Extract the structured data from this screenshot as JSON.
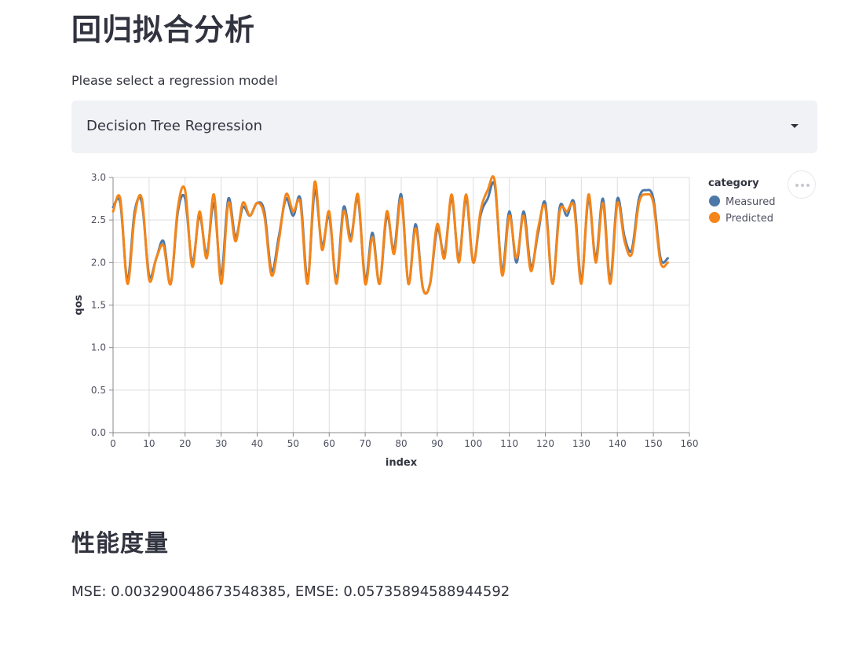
{
  "page": {
    "title": "回归拟合分析",
    "select_label": "Please select a regression model",
    "selected_model": "Decision Tree Regression"
  },
  "menu": {
    "icon": "more-horizontal-icon"
  },
  "metrics": {
    "title": "性能度量",
    "text": "MSE: 0.003290048673548385, EMSE: 0.05735894588944592"
  },
  "colors": {
    "measured": "#4c78a8",
    "predicted": "#f58518",
    "grid": "#dddddd",
    "axis": "#888888",
    "text": "#31333f"
  },
  "chart_data": {
    "type": "line",
    "xlabel": "index",
    "ylabel": "qos",
    "xlim": [
      0,
      160
    ],
    "ylim": [
      0,
      3
    ],
    "x_ticks": [
      0,
      10,
      20,
      30,
      40,
      50,
      60,
      70,
      80,
      90,
      100,
      110,
      120,
      130,
      140,
      150,
      160
    ],
    "y_ticks": [
      0.0,
      0.5,
      1.0,
      1.5,
      2.0,
      2.5,
      3.0
    ],
    "y_tick_labels": [
      "0.0",
      "0.5",
      "1.0",
      "1.5",
      "2.0",
      "2.5",
      "3.0"
    ],
    "grid": true,
    "legend": {
      "title": "category",
      "position": "right"
    },
    "interpolation": "smooth",
    "series": [
      {
        "name": "Measured",
        "color": "#4c78a8",
        "x": [
          0,
          2,
          4,
          6,
          8,
          10,
          12,
          14,
          16,
          18,
          20,
          22,
          24,
          26,
          28,
          30,
          32,
          34,
          36,
          38,
          40,
          42,
          44,
          46,
          48,
          50,
          52,
          54,
          56,
          58,
          60,
          62,
          64,
          66,
          68,
          70,
          72,
          74,
          76,
          78,
          80,
          82,
          84,
          86,
          88,
          90,
          92,
          94,
          96,
          98,
          100,
          102,
          104,
          106,
          108,
          110,
          112,
          114,
          116,
          118,
          120,
          122,
          124,
          126,
          128,
          130,
          132,
          134,
          136,
          138,
          140,
          142,
          144,
          146,
          148,
          150,
          152,
          154
        ],
        "y": [
          2.65,
          2.7,
          1.8,
          2.6,
          2.7,
          1.85,
          2.05,
          2.25,
          1.75,
          2.6,
          2.75,
          2.0,
          2.55,
          2.1,
          2.7,
          1.85,
          2.75,
          2.3,
          2.65,
          2.55,
          2.7,
          2.6,
          1.9,
          2.3,
          2.75,
          2.55,
          2.75,
          1.8,
          2.85,
          2.2,
          2.55,
          1.8,
          2.65,
          2.3,
          2.75,
          1.8,
          2.35,
          1.75,
          2.55,
          2.15,
          2.8,
          1.75,
          2.45,
          1.7,
          1.75,
          2.4,
          2.1,
          2.75,
          2.05,
          2.75,
          2.0,
          2.55,
          2.75,
          2.9,
          1.9,
          2.6,
          2.0,
          2.6,
          1.95,
          2.35,
          2.7,
          1.75,
          2.65,
          2.55,
          2.7,
          1.8,
          2.75,
          2.05,
          2.75,
          1.8,
          2.75,
          2.3,
          2.15,
          2.75,
          2.85,
          2.75,
          2.05,
          2.05
        ]
      },
      {
        "name": "Predicted",
        "color": "#f58518",
        "x": [
          0,
          2,
          4,
          6,
          8,
          10,
          12,
          14,
          16,
          18,
          20,
          22,
          24,
          26,
          28,
          30,
          32,
          34,
          36,
          38,
          40,
          42,
          44,
          46,
          48,
          50,
          52,
          54,
          56,
          58,
          60,
          62,
          64,
          66,
          68,
          70,
          72,
          74,
          76,
          78,
          80,
          82,
          84,
          86,
          88,
          90,
          92,
          94,
          96,
          98,
          100,
          102,
          104,
          106,
          108,
          110,
          112,
          114,
          116,
          118,
          120,
          122,
          124,
          126,
          128,
          130,
          132,
          134,
          136,
          138,
          140,
          142,
          144,
          146,
          148,
          150,
          152,
          154
        ],
        "y": [
          2.6,
          2.75,
          1.75,
          2.55,
          2.75,
          1.8,
          2.05,
          2.2,
          1.75,
          2.65,
          2.85,
          1.95,
          2.6,
          2.05,
          2.8,
          1.75,
          2.7,
          2.25,
          2.7,
          2.55,
          2.7,
          2.55,
          1.85,
          2.25,
          2.8,
          2.6,
          2.7,
          1.75,
          2.95,
          2.15,
          2.6,
          1.75,
          2.6,
          2.25,
          2.8,
          1.75,
          2.3,
          1.75,
          2.6,
          2.1,
          2.75,
          1.75,
          2.4,
          1.7,
          1.75,
          2.45,
          2.05,
          2.8,
          2.0,
          2.8,
          2.0,
          2.6,
          2.85,
          2.95,
          1.85,
          2.55,
          2.05,
          2.55,
          1.9,
          2.4,
          2.65,
          1.75,
          2.6,
          2.6,
          2.65,
          1.75,
          2.8,
          2.0,
          2.7,
          1.75,
          2.7,
          2.25,
          2.1,
          2.7,
          2.8,
          2.7,
          2.0,
          2.0
        ]
      }
    ]
  }
}
